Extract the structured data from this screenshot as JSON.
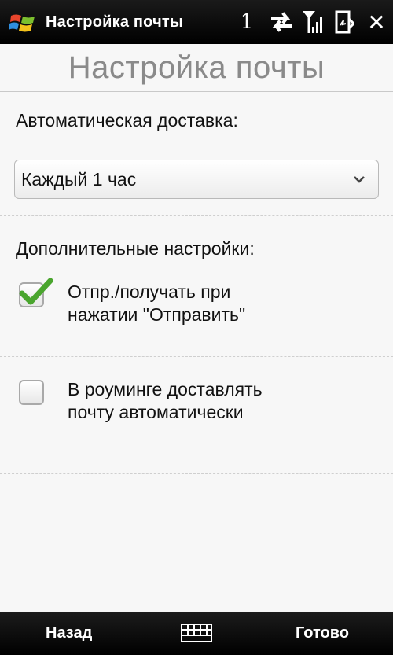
{
  "statusbar": {
    "title": "Настройка почты",
    "notification_count": "1",
    "icons": [
      "windows-start-icon",
      "data-transfer-icon",
      "signal-icon",
      "battery-icon",
      "close-icon"
    ]
  },
  "page": {
    "title": "Настройка почты"
  },
  "delivery": {
    "label": "Автоматическая доставка:",
    "selected": "Каждый 1 час"
  },
  "advanced": {
    "label": "Дополнительные настройки:",
    "options": [
      {
        "line1": "Отпр./получать при",
        "line2": "нажатии \"Отправить\"",
        "checked": true
      },
      {
        "line1": "В роуминге доставлять",
        "line2": "почту автоматически",
        "checked": false
      }
    ]
  },
  "softkeys": {
    "left": "Назад",
    "right": "Готово",
    "center_icon": "keyboard-icon"
  },
  "colors": {
    "checkmark": "#4aa52e",
    "title_gray": "#8a8a8a"
  }
}
